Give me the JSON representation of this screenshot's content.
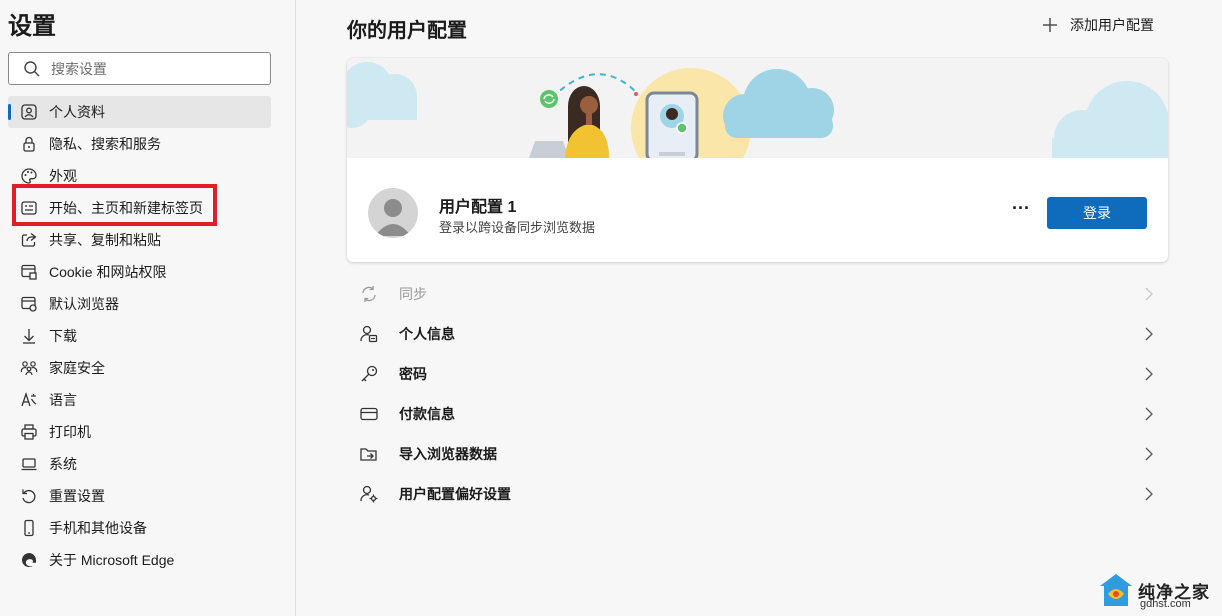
{
  "sidebar": {
    "title": "设置",
    "search_placeholder": "搜索设置",
    "items": [
      {
        "label": "个人资料",
        "icon": "profile-icon",
        "active": true
      },
      {
        "label": "隐私、搜索和服务",
        "icon": "lock-icon"
      },
      {
        "label": "外观",
        "icon": "palette-icon"
      },
      {
        "label": "开始、主页和新建标签页",
        "icon": "home-tab-icon"
      },
      {
        "label": "共享、复制和粘贴",
        "icon": "share-icon"
      },
      {
        "label": "Cookie 和网站权限",
        "icon": "site-permissions-icon"
      },
      {
        "label": "默认浏览器",
        "icon": "browser-icon"
      },
      {
        "label": "下载",
        "icon": "download-icon"
      },
      {
        "label": "家庭安全",
        "icon": "family-icon"
      },
      {
        "label": "语言",
        "icon": "language-icon"
      },
      {
        "label": "打印机",
        "icon": "printer-icon"
      },
      {
        "label": "系统",
        "icon": "laptop-icon"
      },
      {
        "label": "重置设置",
        "icon": "reset-icon"
      },
      {
        "label": "手机和其他设备",
        "icon": "phone-icon"
      },
      {
        "label": "关于 Microsoft Edge",
        "icon": "edge-icon"
      }
    ]
  },
  "main": {
    "title": "你的用户配置",
    "add_profile_label": "添加用户配置",
    "profile": {
      "name": "用户配置 1",
      "subtitle": "登录以跨设备同步浏览数据",
      "more_label": "···",
      "login_label": "登录"
    },
    "settings": [
      {
        "label": "同步",
        "icon": "sync-icon",
        "disabled": true
      },
      {
        "label": "个人信息",
        "icon": "personal-info-icon"
      },
      {
        "label": "密码",
        "icon": "key-icon"
      },
      {
        "label": "付款信息",
        "icon": "card-icon"
      },
      {
        "label": "导入浏览器数据",
        "icon": "import-icon"
      },
      {
        "label": "用户配置偏好设置",
        "icon": "profile-prefs-icon"
      }
    ]
  },
  "watermark": {
    "text": "纯净之家",
    "url": "gdhst.com"
  },
  "colors": {
    "accent": "#0f6cbd",
    "highlight": "#e01e26",
    "background": "#f7f7f7"
  }
}
